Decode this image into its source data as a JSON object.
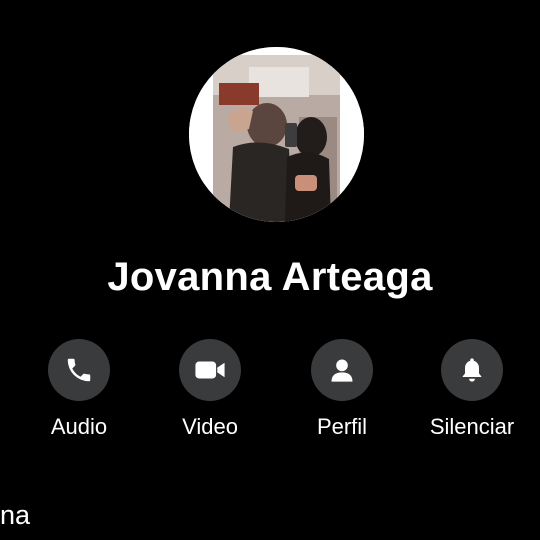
{
  "contact": {
    "name": "Jovanna Arteaga"
  },
  "actions": [
    {
      "label": "Audio",
      "icon": "phone-icon"
    },
    {
      "label": "Video",
      "icon": "video-camera-icon"
    },
    {
      "label": "Perfil",
      "icon": "person-icon"
    },
    {
      "label": "Silenciar",
      "icon": "bell-icon"
    }
  ],
  "below": {
    "partial_text": "na"
  },
  "colors": {
    "background": "#000000",
    "button_circle": "#3a3b3c",
    "text": "#ffffff"
  }
}
